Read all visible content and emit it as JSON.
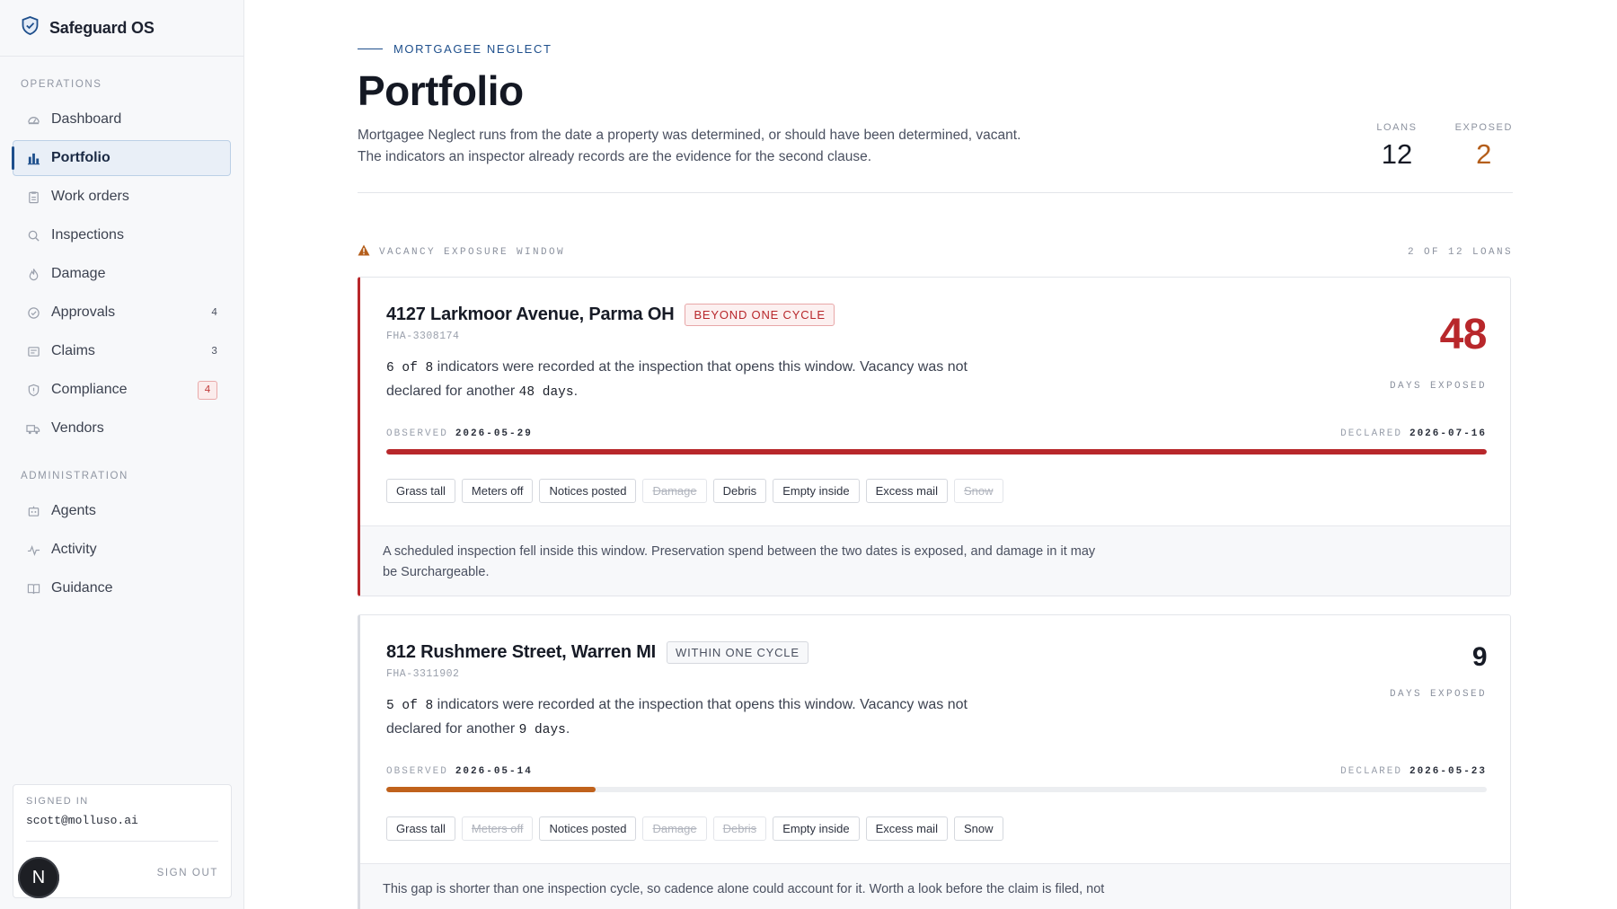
{
  "app": {
    "title": "Safeguard OS"
  },
  "sidebar": {
    "operations_label": "OPERATIONS",
    "operations": [
      {
        "label": "Dashboard",
        "icon": "dashboard-icon"
      },
      {
        "label": "Portfolio",
        "icon": "portfolio-icon",
        "active": true
      },
      {
        "label": "Work orders",
        "icon": "clipboard-icon"
      },
      {
        "label": "Inspections",
        "icon": "search-icon"
      },
      {
        "label": "Damage",
        "icon": "flame-icon"
      },
      {
        "label": "Approvals",
        "icon": "check-circle-icon",
        "count": "4"
      },
      {
        "label": "Claims",
        "icon": "claims-icon",
        "count": "3"
      },
      {
        "label": "Compliance",
        "icon": "shield-icon",
        "badge": "4"
      },
      {
        "label": "Vendors",
        "icon": "truck-icon"
      }
    ],
    "administration_label": "ADMINISTRATION",
    "administration": [
      {
        "label": "Agents",
        "icon": "agents-icon"
      },
      {
        "label": "Activity",
        "icon": "activity-icon"
      },
      {
        "label": "Guidance",
        "icon": "book-icon"
      }
    ],
    "signed_in_label": "SIGNED IN",
    "user_email": "scott@molluso.ai",
    "sign_out_label": "SIGN OUT",
    "avatar_letter": "N"
  },
  "header": {
    "eyebrow": "MORTGAGEE NEGLECT",
    "title": "Portfolio",
    "intro": "Mortgagee Neglect runs from the date a property was determined, or should have been determined, vacant. The indicators an inspector already records are the evidence for the second clause.",
    "stats": [
      {
        "label": "LOANS",
        "value": "12"
      },
      {
        "label": "EXPOSED",
        "value": "2"
      }
    ]
  },
  "window": {
    "label": "VACANCY EXPOSURE WINDOW",
    "count": "2 OF 12 LOANS"
  },
  "cards": [
    {
      "address": "4127 Larkmoor Avenue, Parma OH",
      "status": "BEYOND ONE CYCLE",
      "loan_id": "FHA-3308174",
      "indicators": "6 of 8",
      "desc_mid": "indicators were recorded at the inspection that opens this window. Vacancy was not declared for another",
      "days_text": "48 days",
      "desc_end": ".",
      "days_exposed": "48",
      "days_label": "DAYS EXPOSED",
      "observed_label": "OBSERVED",
      "observed": "2026-05-29",
      "declared_label": "DECLARED",
      "declared": "2026-07-16",
      "bar_fraction": 1.0,
      "bar_color": "#b8272b",
      "tags": [
        {
          "label": "Grass tall",
          "on": true
        },
        {
          "label": "Meters off",
          "on": true
        },
        {
          "label": "Notices posted",
          "on": true
        },
        {
          "label": "Damage",
          "on": false
        },
        {
          "label": "Debris",
          "on": true
        },
        {
          "label": "Empty inside",
          "on": true
        },
        {
          "label": "Excess mail",
          "on": true
        },
        {
          "label": "Snow",
          "on": false
        }
      ],
      "note": "A scheduled inspection fell inside this window. Preservation spend between the two dates is exposed, and damage in it may be Surchargeable."
    },
    {
      "address": "812 Rushmere Street, Warren MI",
      "status": "WITHIN ONE CYCLE",
      "loan_id": "FHA-3311902",
      "indicators": "5 of 8",
      "desc_mid": "indicators were recorded at the inspection that opens this window. Vacancy was not declared for another",
      "days_text": "9 days",
      "desc_end": ".",
      "days_exposed": "9",
      "days_label": "DAYS EXPOSED",
      "observed_label": "OBSERVED",
      "observed": "2026-05-14",
      "declared_label": "DECLARED",
      "declared": "2026-05-23",
      "bar_fraction": 0.19,
      "bar_color": "#c0621c",
      "tags": [
        {
          "label": "Grass tall",
          "on": true
        },
        {
          "label": "Meters off",
          "on": false
        },
        {
          "label": "Notices posted",
          "on": true
        },
        {
          "label": "Damage",
          "on": false
        },
        {
          "label": "Debris",
          "on": false
        },
        {
          "label": "Empty inside",
          "on": true
        },
        {
          "label": "Excess mail",
          "on": true
        },
        {
          "label": "Snow",
          "on": true
        }
      ],
      "note": "This gap is shorter than one inspection cycle, so cadence alone could account for it. Worth a look before the claim is filed, not"
    }
  ]
}
